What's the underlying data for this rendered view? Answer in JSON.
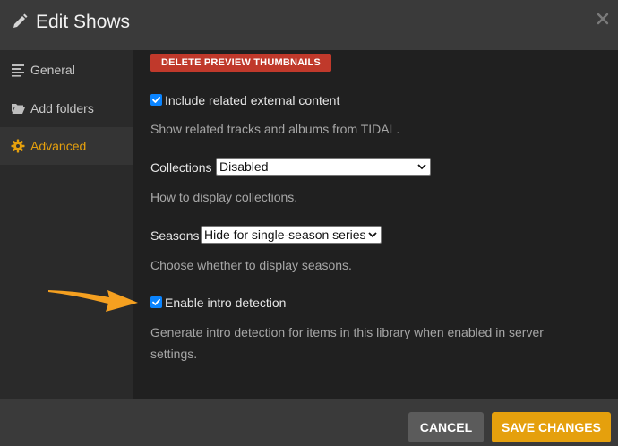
{
  "header": {
    "title": "Edit Shows",
    "pencil_icon": "pencil-icon",
    "close_icon": "close-icon"
  },
  "sidebar": {
    "items": [
      {
        "label": "General",
        "icon": "list-icon",
        "active": false
      },
      {
        "label": "Add folders",
        "icon": "folder-icon",
        "active": false
      },
      {
        "label": "Advanced",
        "icon": "gear-icon",
        "active": true
      }
    ]
  },
  "content": {
    "delete_preview_label": "DELETE PREVIEW THUMBNAILS",
    "external_content": {
      "label": "Include related external content",
      "checked": true,
      "help": "Show related tracks and albums from TIDAL."
    },
    "collections": {
      "label": "Collections",
      "value": "Disabled",
      "help": "How to display collections."
    },
    "seasons": {
      "label": "Seasons",
      "value": "Hide for single-season series",
      "help": "Choose whether to display seasons."
    },
    "intro_detection": {
      "label": "Enable intro detection",
      "checked": true,
      "help": "Generate intro detection for items in this library when enabled in server settings."
    }
  },
  "footer": {
    "cancel_label": "CANCEL",
    "save_label": "SAVE CHANGES"
  },
  "colors": {
    "accent": "#e5a00d",
    "danger": "#c0392b",
    "checkbox": "#0a84ff",
    "annotation_arrow": "#f5a020"
  }
}
